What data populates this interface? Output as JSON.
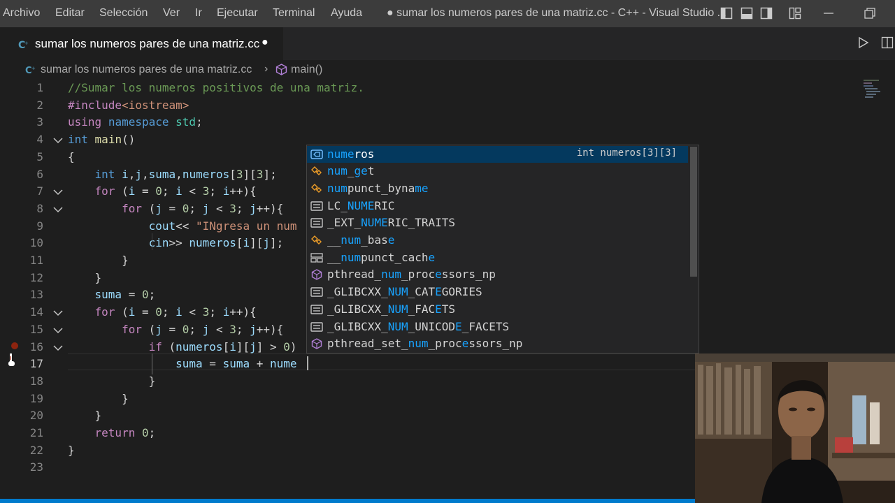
{
  "titlebar": {
    "menus": [
      "Archivo",
      "Editar",
      "Selección",
      "Ver",
      "Ir",
      "Ejecutar",
      "Terminal",
      "Ayuda"
    ],
    "window_title": "● sumar los numeros pares de una matriz.cc - C++ - Visual Studio ..."
  },
  "tab": {
    "label": "sumar los numeros pares de una matriz.cc",
    "modified_dot": "●"
  },
  "breadcrumb": {
    "file": "sumar los numeros pares de una matriz.cc",
    "separator": "›",
    "symbol": "main()"
  },
  "code": {
    "line_numbers": [
      "1",
      "2",
      "3",
      "4",
      "5",
      "6",
      "7",
      "8",
      "9",
      "10",
      "11",
      "12",
      "13",
      "14",
      "15",
      "16",
      "17",
      "18",
      "19",
      "20",
      "21",
      "22",
      "23"
    ],
    "lines": [
      [
        [
          "c-com",
          "//Sumar los numeros positivos de una matriz."
        ]
      ],
      [
        [
          "c-inc",
          "#include"
        ],
        [
          "c-str",
          "<iostream>"
        ]
      ],
      [
        [
          "c-ctl",
          "using"
        ],
        [
          "",
          " "
        ],
        [
          "c-kw",
          "namespace"
        ],
        [
          "",
          " "
        ],
        [
          "c-type",
          "std"
        ],
        [
          "",
          ";"
        ]
      ],
      [
        [
          "c-kw",
          "int"
        ],
        [
          "",
          " "
        ],
        [
          "c-fn",
          "main"
        ],
        [
          "",
          "()"
        ]
      ],
      [
        [
          "",
          "{"
        ]
      ],
      [
        [
          "",
          "    "
        ],
        [
          "c-kw",
          "int"
        ],
        [
          "",
          " "
        ],
        [
          "c-var",
          "i"
        ],
        [
          "",
          ","
        ],
        [
          "c-var",
          "j"
        ],
        [
          "",
          ","
        ],
        [
          "c-var",
          "suma"
        ],
        [
          "",
          ","
        ],
        [
          "c-var",
          "numeros"
        ],
        [
          "",
          "["
        ],
        [
          "c-num",
          "3"
        ],
        [
          "",
          "]["
        ],
        [
          "c-num",
          "3"
        ],
        [
          "",
          "];"
        ]
      ],
      [
        [
          "",
          "    "
        ],
        [
          "c-ctl",
          "for"
        ],
        [
          "",
          " ("
        ],
        [
          "c-var",
          "i"
        ],
        [
          "",
          " = "
        ],
        [
          "c-num",
          "0"
        ],
        [
          "",
          "; "
        ],
        [
          "c-var",
          "i"
        ],
        [
          "",
          " < "
        ],
        [
          "c-num",
          "3"
        ],
        [
          "",
          "; "
        ],
        [
          "c-var",
          "i"
        ],
        [
          "",
          "++){"
        ]
      ],
      [
        [
          "",
          "        "
        ],
        [
          "c-ctl",
          "for"
        ],
        [
          "",
          " ("
        ],
        [
          "c-var",
          "j"
        ],
        [
          "",
          " = "
        ],
        [
          "c-num",
          "0"
        ],
        [
          "",
          "; "
        ],
        [
          "c-var",
          "j"
        ],
        [
          "",
          " < "
        ],
        [
          "c-num",
          "3"
        ],
        [
          "",
          "; "
        ],
        [
          "c-var",
          "j"
        ],
        [
          "",
          "++){"
        ]
      ],
      [
        [
          "",
          "            "
        ],
        [
          "c-var",
          "cout"
        ],
        [
          "",
          "<< "
        ],
        [
          "c-str",
          "\"INgresa un num"
        ]
      ],
      [
        [
          "",
          "            "
        ],
        [
          "c-var",
          "cin"
        ],
        [
          "",
          ">> "
        ],
        [
          "c-var",
          "numeros"
        ],
        [
          "",
          "["
        ],
        [
          "c-var",
          "i"
        ],
        [
          "",
          "]["
        ],
        [
          "c-var",
          "j"
        ],
        [
          "",
          "];"
        ]
      ],
      [
        [
          "",
          "        }"
        ]
      ],
      [
        [
          "",
          "    }"
        ]
      ],
      [
        [
          "",
          "    "
        ],
        [
          "c-var",
          "suma"
        ],
        [
          "",
          " = "
        ],
        [
          "c-num",
          "0"
        ],
        [
          "",
          ";"
        ]
      ],
      [
        [
          "",
          "    "
        ],
        [
          "c-ctl",
          "for"
        ],
        [
          "",
          " ("
        ],
        [
          "c-var",
          "i"
        ],
        [
          "",
          " = "
        ],
        [
          "c-num",
          "0"
        ],
        [
          "",
          "; "
        ],
        [
          "c-var",
          "i"
        ],
        [
          "",
          " < "
        ],
        [
          "c-num",
          "3"
        ],
        [
          "",
          "; "
        ],
        [
          "c-var",
          "i"
        ],
        [
          "",
          "++){"
        ]
      ],
      [
        [
          "",
          "        "
        ],
        [
          "c-ctl",
          "for"
        ],
        [
          "",
          " ("
        ],
        [
          "c-var",
          "j"
        ],
        [
          "",
          " = "
        ],
        [
          "c-num",
          "0"
        ],
        [
          "",
          "; "
        ],
        [
          "c-var",
          "j"
        ],
        [
          "",
          " < "
        ],
        [
          "c-num",
          "3"
        ],
        [
          "",
          "; "
        ],
        [
          "c-var",
          "j"
        ],
        [
          "",
          "++){"
        ]
      ],
      [
        [
          "",
          "            "
        ],
        [
          "c-ctl",
          "if"
        ],
        [
          "",
          " ("
        ],
        [
          "c-var",
          "numeros"
        ],
        [
          "",
          "["
        ],
        [
          "c-var",
          "i"
        ],
        [
          "",
          "]["
        ],
        [
          "c-var",
          "j"
        ],
        [
          "",
          "] > "
        ],
        [
          "c-num",
          "0"
        ],
        [
          "",
          ")"
        ]
      ],
      [
        [
          "",
          "                "
        ],
        [
          "c-var",
          "suma"
        ],
        [
          "",
          " = "
        ],
        [
          "c-var",
          "suma"
        ],
        [
          "",
          " + "
        ],
        [
          "c-var",
          "nume"
        ]
      ],
      [
        [
          "",
          "            }"
        ]
      ],
      [
        [
          "",
          "        }"
        ]
      ],
      [
        [
          "",
          "    }"
        ]
      ],
      [
        [
          "",
          "    "
        ],
        [
          "c-ctl",
          "return"
        ],
        [
          "",
          " "
        ],
        [
          "c-num",
          "0"
        ],
        [
          "",
          ";"
        ]
      ],
      [
        [
          "",
          "}"
        ]
      ],
      [
        [
          "",
          ""
        ]
      ]
    ]
  },
  "suggest": {
    "items": [
      {
        "icon": "variable-icon",
        "parts": [
          [
            "hl",
            "nume"
          ],
          [
            "",
            "ros"
          ]
        ],
        "detail": "int numeros[3][3]",
        "selected": true
      },
      {
        "icon": "class-icon",
        "parts": [
          [
            "hl",
            "num"
          ],
          [
            "",
            "_"
          ],
          [
            "hl",
            "ge"
          ],
          [
            "",
            "t"
          ]
        ],
        "detail": "",
        "selected": false
      },
      {
        "icon": "class-icon",
        "parts": [
          [
            "hl",
            "num"
          ],
          [
            "",
            "punct_byna"
          ],
          [
            "hl",
            "me"
          ]
        ],
        "detail": "",
        "selected": false
      },
      {
        "icon": "constant-icon",
        "parts": [
          [
            "",
            "LC_"
          ],
          [
            "hl",
            "NUME"
          ],
          [
            "",
            "RIC"
          ]
        ],
        "detail": "",
        "selected": false
      },
      {
        "icon": "constant-icon",
        "parts": [
          [
            "",
            "_EXT_"
          ],
          [
            "hl",
            "NUME"
          ],
          [
            "",
            "RIC_TRAITS"
          ]
        ],
        "detail": "",
        "selected": false
      },
      {
        "icon": "class-icon",
        "parts": [
          [
            "",
            "__"
          ],
          [
            "hl",
            "num"
          ],
          [
            "",
            "_bas"
          ],
          [
            "hl",
            "e"
          ]
        ],
        "detail": "",
        "selected": false
      },
      {
        "icon": "struct-icon",
        "parts": [
          [
            "",
            "__"
          ],
          [
            "hl",
            "num"
          ],
          [
            "",
            "punct_cach"
          ],
          [
            "hl",
            "e"
          ]
        ],
        "detail": "",
        "selected": false
      },
      {
        "icon": "method-icon",
        "parts": [
          [
            "",
            "pthread_"
          ],
          [
            "hl",
            "num"
          ],
          [
            "",
            "_proc"
          ],
          [
            "hl",
            "e"
          ],
          [
            "",
            "ssors_np"
          ]
        ],
        "detail": "",
        "selected": false
      },
      {
        "icon": "constant-icon",
        "parts": [
          [
            "",
            "_GLIBCXX_"
          ],
          [
            "hl",
            "NUM"
          ],
          [
            "",
            "_CAT"
          ],
          [
            "hl",
            "E"
          ],
          [
            "",
            "GORIES"
          ]
        ],
        "detail": "",
        "selected": false
      },
      {
        "icon": "constant-icon",
        "parts": [
          [
            "",
            "_GLIBCXX_"
          ],
          [
            "hl",
            "NUM"
          ],
          [
            "",
            "_FAC"
          ],
          [
            "hl",
            "E"
          ],
          [
            "",
            "TS"
          ]
        ],
        "detail": "",
        "selected": false
      },
      {
        "icon": "constant-icon",
        "parts": [
          [
            "",
            "_GLIBCXX_"
          ],
          [
            "hl",
            "NUM"
          ],
          [
            "",
            "_UNICOD"
          ],
          [
            "hl",
            "E"
          ],
          [
            "",
            "_FACETS"
          ]
        ],
        "detail": "",
        "selected": false
      },
      {
        "icon": "method-icon",
        "parts": [
          [
            "",
            "pthread_set_"
          ],
          [
            "hl",
            "num"
          ],
          [
            "",
            "_proc"
          ],
          [
            "hl",
            "e"
          ],
          [
            "",
            "ssors_np"
          ]
        ],
        "detail": "",
        "selected": false
      }
    ]
  },
  "colors": {
    "accent": "#007acc",
    "editor_bg": "#1e1e1e",
    "suggest_selected": "#04395e",
    "match_highlight": "#18a3ff",
    "breakpoint": "#a1260d"
  }
}
